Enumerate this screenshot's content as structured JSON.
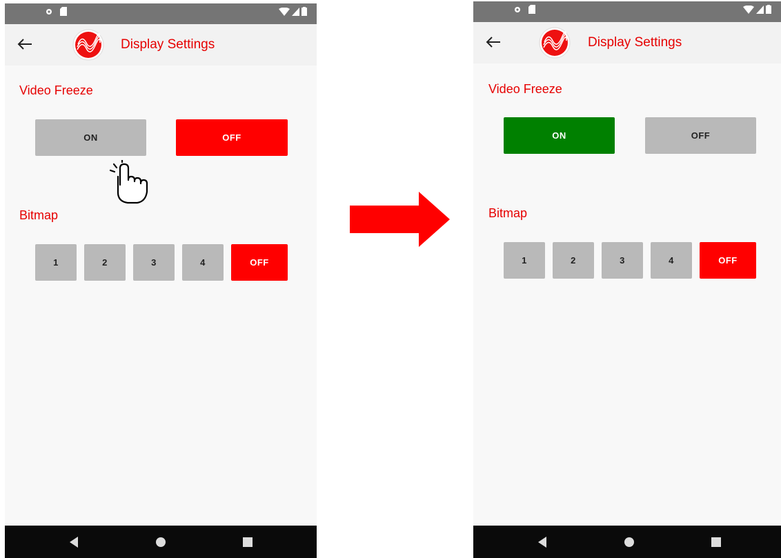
{
  "left": {
    "title": "Display Settings",
    "video_freeze": {
      "label": "Video Freeze",
      "on": "ON",
      "off": "OFF"
    },
    "bitmap": {
      "label": "Bitmap",
      "options": [
        "1",
        "2",
        "3",
        "4",
        "OFF"
      ]
    }
  },
  "right": {
    "title": "Display Settings",
    "video_freeze": {
      "label": "Video Freeze",
      "on": "ON",
      "off": "OFF"
    },
    "bitmap": {
      "label": "Bitmap",
      "options": [
        "1",
        "2",
        "3",
        "4",
        "OFF"
      ]
    }
  },
  "colors": {
    "accent_red": "#ff0000",
    "active_green": "#008000",
    "inactive_gray": "#b9b9b9",
    "nav_bar": "#0a0a0a"
  }
}
